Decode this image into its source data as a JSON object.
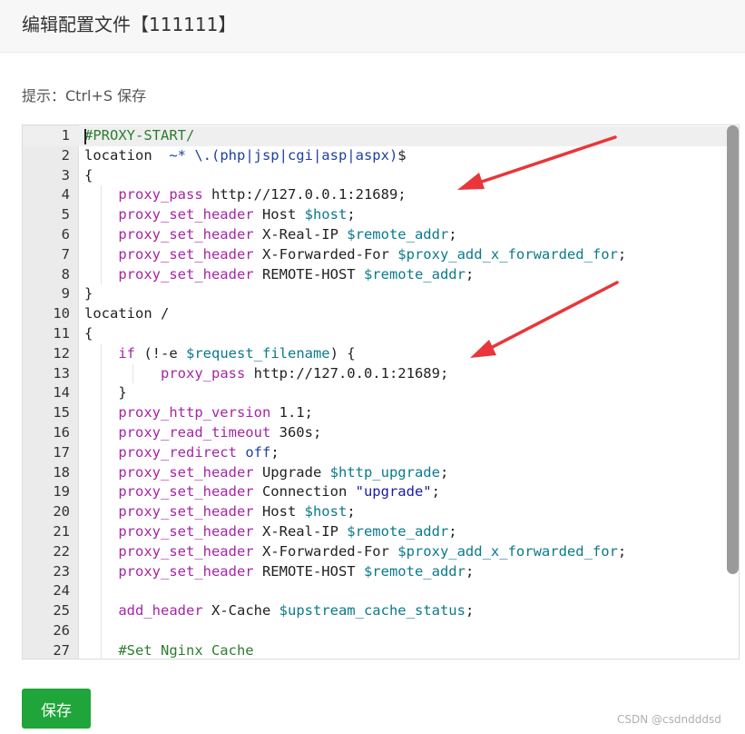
{
  "dialog": {
    "title": "编辑配置文件【111111】"
  },
  "hint": "提示：Ctrl+S 保存",
  "editor": {
    "lines": [
      {
        "n": "1",
        "tokens": [
          [
            "c",
            "#PROXY-START/"
          ]
        ]
      },
      {
        "n": "2",
        "tokens": [
          [
            "p",
            "location  "
          ],
          [
            "r",
            "~* \\.(php|jsp|cgi|asp|aspx)"
          ],
          [
            "p",
            "$"
          ]
        ]
      },
      {
        "n": "3",
        "tokens": [
          [
            "p",
            "{"
          ]
        ]
      },
      {
        "n": "4",
        "tokens": [
          [
            "p",
            "    "
          ],
          [
            "k",
            "proxy_pass"
          ],
          [
            "p",
            " http://127.0.0.1:21689;"
          ]
        ]
      },
      {
        "n": "5",
        "tokens": [
          [
            "p",
            "    "
          ],
          [
            "k",
            "proxy_set_header"
          ],
          [
            "p",
            " Host "
          ],
          [
            "v",
            "$host"
          ],
          [
            "p",
            ";"
          ]
        ]
      },
      {
        "n": "6",
        "tokens": [
          [
            "p",
            "    "
          ],
          [
            "k",
            "proxy_set_header"
          ],
          [
            "p",
            " X-Real-IP "
          ],
          [
            "v",
            "$remote_addr"
          ],
          [
            "p",
            ";"
          ]
        ]
      },
      {
        "n": "7",
        "tokens": [
          [
            "p",
            "    "
          ],
          [
            "k",
            "proxy_set_header"
          ],
          [
            "p",
            " X-Forwarded-For "
          ],
          [
            "v",
            "$proxy_add_x_forwarded_for"
          ],
          [
            "p",
            ";"
          ]
        ]
      },
      {
        "n": "8",
        "tokens": [
          [
            "p",
            "    "
          ],
          [
            "k",
            "proxy_set_header"
          ],
          [
            "p",
            " REMOTE-HOST "
          ],
          [
            "v",
            "$remote_addr"
          ],
          [
            "p",
            ";"
          ]
        ]
      },
      {
        "n": "9",
        "tokens": [
          [
            "p",
            "}"
          ]
        ]
      },
      {
        "n": "10",
        "tokens": [
          [
            "p",
            "location /"
          ]
        ]
      },
      {
        "n": "11",
        "tokens": [
          [
            "p",
            "{"
          ]
        ]
      },
      {
        "n": "12",
        "tokens": [
          [
            "p",
            "    "
          ],
          [
            "k",
            "if"
          ],
          [
            "p",
            " (!-e "
          ],
          [
            "v",
            "$request_filename"
          ],
          [
            "p",
            ") {"
          ]
        ]
      },
      {
        "n": "13",
        "tokens": [
          [
            "p",
            "         "
          ],
          [
            "k",
            "proxy_pass"
          ],
          [
            "p",
            " http://127.0.0.1:21689;"
          ]
        ]
      },
      {
        "n": "14",
        "tokens": [
          [
            "p",
            "    }"
          ]
        ]
      },
      {
        "n": "15",
        "tokens": [
          [
            "p",
            "    "
          ],
          [
            "k",
            "proxy_http_version"
          ],
          [
            "p",
            " 1.1;"
          ]
        ]
      },
      {
        "n": "16",
        "tokens": [
          [
            "p",
            "    "
          ],
          [
            "k",
            "proxy_read_timeout"
          ],
          [
            "p",
            " 360s;"
          ]
        ]
      },
      {
        "n": "17",
        "tokens": [
          [
            "p",
            "    "
          ],
          [
            "k",
            "proxy_redirect"
          ],
          [
            "p",
            " "
          ],
          [
            "r",
            "off"
          ],
          [
            "p",
            ";"
          ]
        ]
      },
      {
        "n": "18",
        "tokens": [
          [
            "p",
            "    "
          ],
          [
            "k",
            "proxy_set_header"
          ],
          [
            "p",
            " Upgrade "
          ],
          [
            "v",
            "$http_upgrade"
          ],
          [
            "p",
            ";"
          ]
        ]
      },
      {
        "n": "19",
        "tokens": [
          [
            "p",
            "    "
          ],
          [
            "k",
            "proxy_set_header"
          ],
          [
            "p",
            " Connection "
          ],
          [
            "s",
            "\"upgrade\""
          ],
          [
            "p",
            ";"
          ]
        ]
      },
      {
        "n": "20",
        "tokens": [
          [
            "p",
            "    "
          ],
          [
            "k",
            "proxy_set_header"
          ],
          [
            "p",
            " Host "
          ],
          [
            "v",
            "$host"
          ],
          [
            "p",
            ";"
          ]
        ]
      },
      {
        "n": "21",
        "tokens": [
          [
            "p",
            "    "
          ],
          [
            "k",
            "proxy_set_header"
          ],
          [
            "p",
            " X-Real-IP "
          ],
          [
            "v",
            "$remote_addr"
          ],
          [
            "p",
            ";"
          ]
        ]
      },
      {
        "n": "22",
        "tokens": [
          [
            "p",
            "    "
          ],
          [
            "k",
            "proxy_set_header"
          ],
          [
            "p",
            " X-Forwarded-For "
          ],
          [
            "v",
            "$proxy_add_x_forwarded_for"
          ],
          [
            "p",
            ";"
          ]
        ]
      },
      {
        "n": "23",
        "tokens": [
          [
            "p",
            "    "
          ],
          [
            "k",
            "proxy_set_header"
          ],
          [
            "p",
            " REMOTE-HOST "
          ],
          [
            "v",
            "$remote_addr"
          ],
          [
            "p",
            ";"
          ]
        ]
      },
      {
        "n": "24",
        "tokens": [
          [
            "p",
            ""
          ]
        ]
      },
      {
        "n": "25",
        "tokens": [
          [
            "p",
            "    "
          ],
          [
            "k",
            "add_header"
          ],
          [
            "p",
            " X-Cache "
          ],
          [
            "v",
            "$upstream_cache_status"
          ],
          [
            "p",
            ";"
          ]
        ]
      },
      {
        "n": "26",
        "tokens": [
          [
            "p",
            ""
          ]
        ]
      },
      {
        "n": "27",
        "tokens": [
          [
            "p",
            "    "
          ],
          [
            "c",
            "#Set Nginx Cache"
          ]
        ]
      }
    ]
  },
  "save_button": {
    "label": "保存"
  },
  "watermark": "CSDN @csdndddsd",
  "colors": {
    "accent": "#20a53a",
    "annotation_arrow": "#e8363a"
  }
}
